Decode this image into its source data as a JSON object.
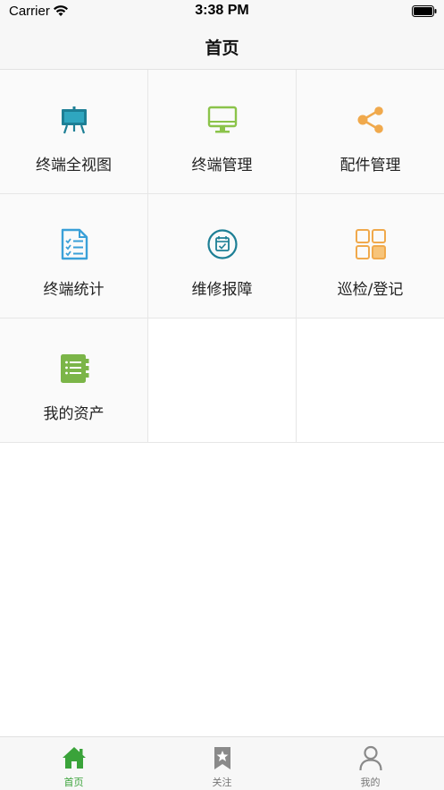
{
  "status_bar": {
    "carrier": "Carrier",
    "time": "3:38 PM"
  },
  "nav": {
    "title": "首页"
  },
  "colors": {
    "teal": "#1d7f95",
    "green": "#8bc34a",
    "orange": "#f0a94c",
    "blue": "#3aa0d8",
    "active_tab": "#3aa33a",
    "inactive_tab": "#888888"
  },
  "grid": {
    "items": [
      {
        "label": "终端全视图",
        "icon": "billboard-icon"
      },
      {
        "label": "终端管理",
        "icon": "monitor-icon"
      },
      {
        "label": "配件管理",
        "icon": "share-icon"
      },
      {
        "label": "终端统计",
        "icon": "checklist-icon"
      },
      {
        "label": "维修报障",
        "icon": "calendar-check-icon"
      },
      {
        "label": "巡检/登记",
        "icon": "tiles-icon"
      },
      {
        "label": "我的资产",
        "icon": "notebook-icon"
      }
    ]
  },
  "tabs": [
    {
      "label": "首页",
      "icon": "home-icon",
      "active": true
    },
    {
      "label": "关注",
      "icon": "star-bookmark-icon",
      "active": false
    },
    {
      "label": "我的",
      "icon": "person-icon",
      "active": false
    }
  ]
}
